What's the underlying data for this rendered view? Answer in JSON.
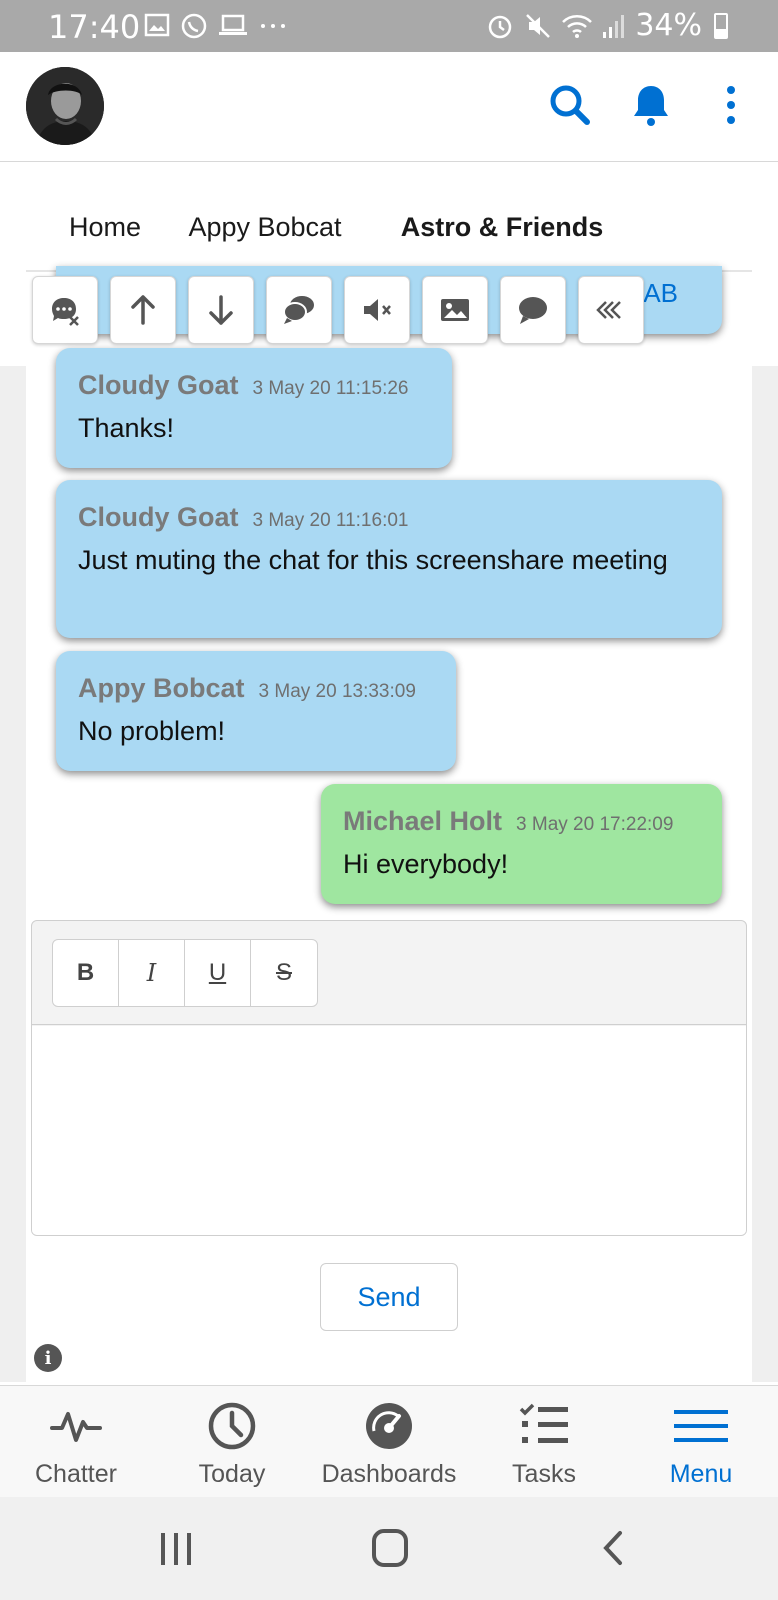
{
  "status_bar": {
    "time": "17:40",
    "battery": "34%"
  },
  "header": {
    "icons": [
      "search-icon",
      "bell-icon",
      "more-vertical-icon"
    ]
  },
  "tabs": [
    {
      "label": "Home",
      "active": false
    },
    {
      "label": "Appy Bobcat",
      "active": false
    },
    {
      "label": "Astro & Friends",
      "active": true
    }
  ],
  "partial_message": {
    "visible_text": "AB"
  },
  "chat_toolbar": {
    "icons": [
      "mute-user-icon",
      "scroll-up-icon",
      "scroll-down-icon",
      "conversations-icon",
      "mute-icon",
      "image-icon",
      "chat-icon",
      "collapse-icon"
    ]
  },
  "messages": [
    {
      "author": "Cloudy Goat",
      "timestamp": "3 May 20 11:15:26",
      "text": "Thanks!",
      "mine": false
    },
    {
      "author": "Cloudy Goat",
      "timestamp": "3 May 20 11:16:01",
      "text": "Just muting the chat for this screenshare meeting",
      "mine": false
    },
    {
      "author": "Appy Bobcat",
      "timestamp": "3 May 20 13:33:09",
      "text": "No problem!",
      "mine": false
    },
    {
      "author": "Michael Holt",
      "timestamp": "3 May 20 17:22:09",
      "text": "Hi everybody!",
      "mine": true
    }
  ],
  "editor": {
    "format_buttons": [
      "B",
      "I",
      "U",
      "S"
    ],
    "value": ""
  },
  "send_label": "Send",
  "bottom_nav": [
    {
      "label": "Chatter",
      "icon": "pulse-icon",
      "active": false
    },
    {
      "label": "Today",
      "icon": "clock-icon",
      "active": false
    },
    {
      "label": "Dashboards",
      "icon": "gauge-icon",
      "active": false
    },
    {
      "label": "Tasks",
      "icon": "checklist-icon",
      "active": false
    },
    {
      "label": "Menu",
      "icon": "hamburger-icon",
      "active": true
    }
  ],
  "colors": {
    "accent": "#0070d2",
    "bubble_other": "#aad9f3",
    "bubble_mine": "#9fe6a0"
  }
}
